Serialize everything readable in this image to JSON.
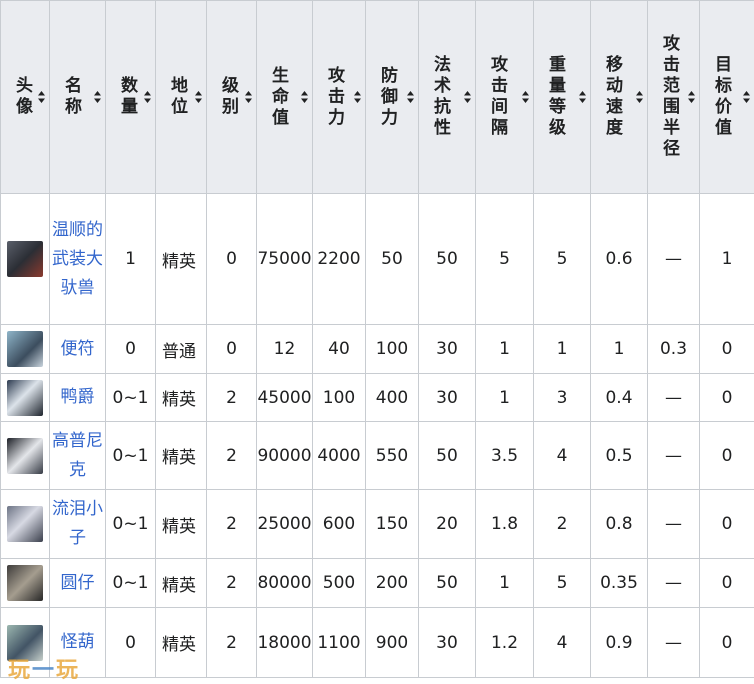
{
  "table": {
    "headers": [
      "头像",
      "名称",
      "数量",
      "地位",
      "级别",
      "生命值",
      "攻击力",
      "防御力",
      "法术抗性",
      "攻击间隔",
      "重量等级",
      "移动速度",
      "攻击范围半径",
      "目标价值"
    ],
    "rows": [
      {
        "avatar": "enemy-portrait",
        "name": "温顺的武装大驮兽",
        "count": "1",
        "rank": "精英",
        "level": "0",
        "hp": "75000",
        "atk": "2200",
        "def": "50",
        "res": "50",
        "interval": "5",
        "weight": "5",
        "speed": "0.6",
        "range": "—",
        "value": "1"
      },
      {
        "avatar": "enemy-portrait",
        "name": "便符",
        "count": "0",
        "rank": "普通",
        "level": "0",
        "hp": "12",
        "atk": "40",
        "def": "100",
        "res": "30",
        "interval": "1",
        "weight": "1",
        "speed": "1",
        "range": "0.3",
        "value": "0"
      },
      {
        "avatar": "enemy-portrait",
        "name": "鸭爵",
        "count": "0~1",
        "rank": "精英",
        "level": "2",
        "hp": "45000",
        "atk": "100",
        "def": "400",
        "res": "30",
        "interval": "1",
        "weight": "3",
        "speed": "0.4",
        "range": "—",
        "value": "0"
      },
      {
        "avatar": "enemy-portrait",
        "name": "高普尼克",
        "count": "0~1",
        "rank": "精英",
        "level": "2",
        "hp": "90000",
        "atk": "4000",
        "def": "550",
        "res": "50",
        "interval": "3.5",
        "weight": "4",
        "speed": "0.5",
        "range": "—",
        "value": "0"
      },
      {
        "avatar": "enemy-portrait",
        "name": "流泪小子",
        "count": "0~1",
        "rank": "精英",
        "level": "2",
        "hp": "25000",
        "atk": "600",
        "def": "150",
        "res": "20",
        "interval": "1.8",
        "weight": "2",
        "speed": "0.8",
        "range": "—",
        "value": "0"
      },
      {
        "avatar": "enemy-portrait",
        "name": "圆仔",
        "count": "0~1",
        "rank": "精英",
        "level": "2",
        "hp": "80000",
        "atk": "500",
        "def": "200",
        "res": "50",
        "interval": "1",
        "weight": "5",
        "speed": "0.35",
        "range": "—",
        "value": "0"
      },
      {
        "avatar": "enemy-portrait",
        "name": "怪葫",
        "count": "0",
        "rank": "精英",
        "level": "2",
        "hp": "18000",
        "atk": "1100",
        "def": "900",
        "res": "30",
        "interval": "1.2",
        "weight": "4",
        "speed": "0.9",
        "range": "—",
        "value": "0"
      }
    ]
  },
  "watermark": {
    "part1": "玩",
    "part2": "一",
    "part3": "玩"
  },
  "colors": {
    "header_bg": "#eaecf0",
    "border": "#c8ccd1",
    "link": "#3366cc"
  }
}
